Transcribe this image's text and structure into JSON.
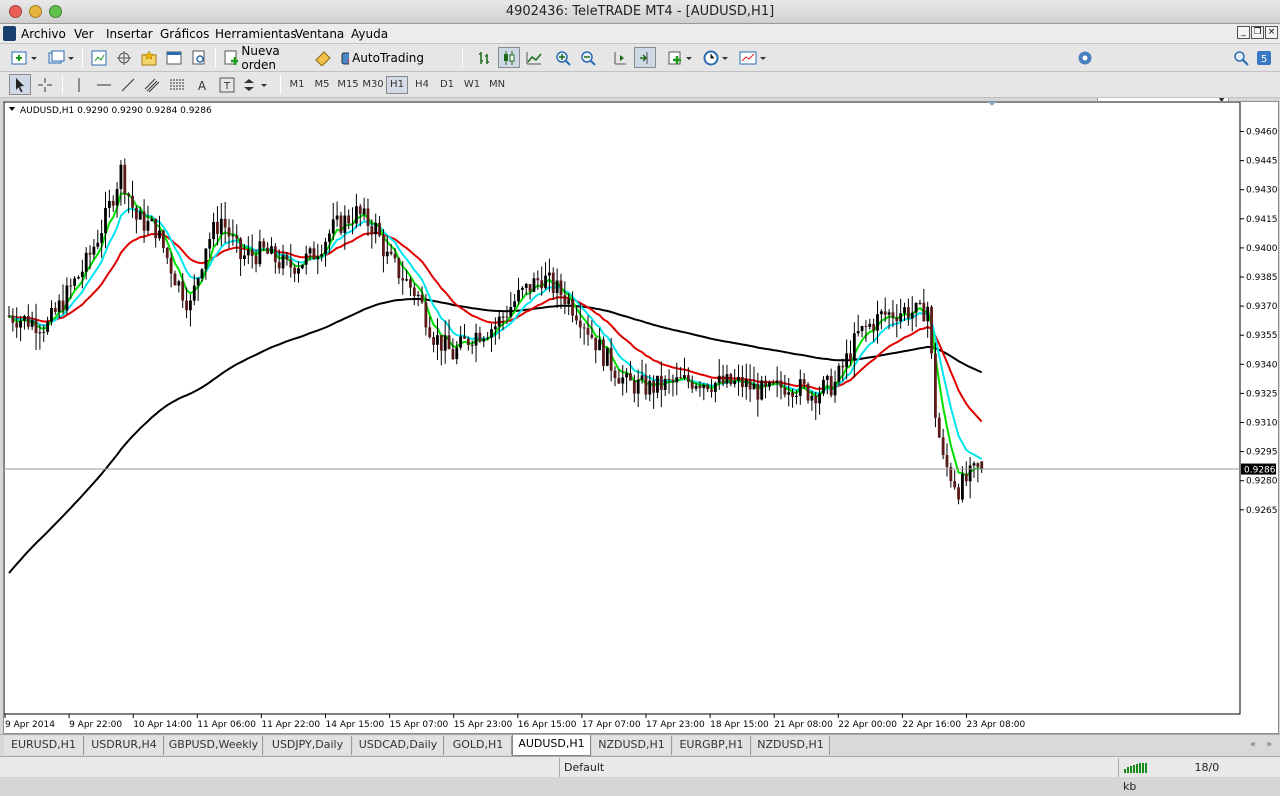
{
  "window": {
    "title": "4902436: TeleTRADE MT4 - [AUDUSD,H1]"
  },
  "menu": [
    "Archivo",
    "Ver",
    "Insertar",
    "Gráficos",
    "Herramientas",
    "Ventana",
    "Ayuda"
  ],
  "toolbar": {
    "new_order_label": "Nueva orden",
    "autotrading_label": "AutoTrading"
  },
  "timeframes": [
    "M1",
    "M5",
    "M15",
    "M30",
    "H1",
    "H4",
    "D1",
    "W1",
    "MN"
  ],
  "selected_timeframe": "H1",
  "chart": {
    "header": "AUDUSD,H1  0.9290 0.9290 0.9284 0.9286",
    "current_price_label": "0.9286",
    "price_axis": [
      "0.9460",
      "0.9445",
      "0.9430",
      "0.9415",
      "0.9400",
      "0.9385",
      "0.9370",
      "0.9355",
      "0.9340",
      "0.9325",
      "0.9310",
      "0.9295",
      "0.9280",
      "0.9265"
    ],
    "time_axis": [
      "9 Apr 2014",
      "9 Apr 22:00",
      "10 Apr 14:00",
      "11 Apr 06:00",
      "11 Apr 22:00",
      "14 Apr 15:00",
      "15 Apr 07:00",
      "15 Apr 23:00",
      "16 Apr 15:00",
      "17 Apr 07:00",
      "17 Apr 23:00",
      "18 Apr 15:00",
      "21 Apr 08:00",
      "22 Apr 00:00",
      "22 Apr 16:00",
      "23 Apr 08:00"
    ],
    "colors": {
      "bull": "#000000",
      "bear": "#5a1a1a",
      "ma_fast": "#00e000",
      "ma_mid": "#00e5ee",
      "ma_slow": "#e00000",
      "ma_long": "#000000"
    }
  },
  "chart_data": {
    "type": "candlestick",
    "symbol": "AUDUSD",
    "timeframe": "H1",
    "ylim": [
      0.926,
      0.9465
    ],
    "last_close": 0.9286,
    "anchors_close": [
      [
        0,
        0.9365
      ],
      [
        10,
        0.936
      ],
      [
        20,
        0.9392
      ],
      [
        25,
        0.9415
      ],
      [
        29,
        0.944
      ],
      [
        33,
        0.9415
      ],
      [
        38,
        0.941
      ],
      [
        43,
        0.9385
      ],
      [
        47,
        0.937
      ],
      [
        51,
        0.9402
      ],
      [
        55,
        0.9415
      ],
      [
        60,
        0.9395
      ],
      [
        66,
        0.9398
      ],
      [
        72,
        0.939
      ],
      [
        78,
        0.9395
      ],
      [
        84,
        0.941
      ],
      [
        90,
        0.9418
      ],
      [
        95,
        0.941
      ],
      [
        98,
        0.9395
      ],
      [
        102,
        0.9385
      ],
      [
        106,
        0.9375
      ],
      [
        110,
        0.9355
      ],
      [
        115,
        0.9345
      ],
      [
        120,
        0.9355
      ],
      [
        126,
        0.936
      ],
      [
        132,
        0.9375
      ],
      [
        138,
        0.9385
      ],
      [
        144,
        0.9375
      ],
      [
        148,
        0.9365
      ],
      [
        154,
        0.9345
      ],
      [
        160,
        0.933
      ],
      [
        166,
        0.9328
      ],
      [
        172,
        0.933
      ],
      [
        178,
        0.9332
      ],
      [
        184,
        0.933
      ],
      [
        190,
        0.933
      ],
      [
        196,
        0.9325
      ],
      [
        202,
        0.933
      ],
      [
        208,
        0.9325
      ],
      [
        214,
        0.933
      ],
      [
        220,
        0.9355
      ],
      [
        226,
        0.9365
      ],
      [
        232,
        0.9368
      ],
      [
        236,
        0.9366
      ],
      [
        238,
        0.937
      ],
      [
        240,
        0.9315
      ],
      [
        242,
        0.929
      ],
      [
        246,
        0.9276
      ],
      [
        250,
        0.9284
      ],
      [
        252,
        0.9286
      ]
    ]
  }
}
